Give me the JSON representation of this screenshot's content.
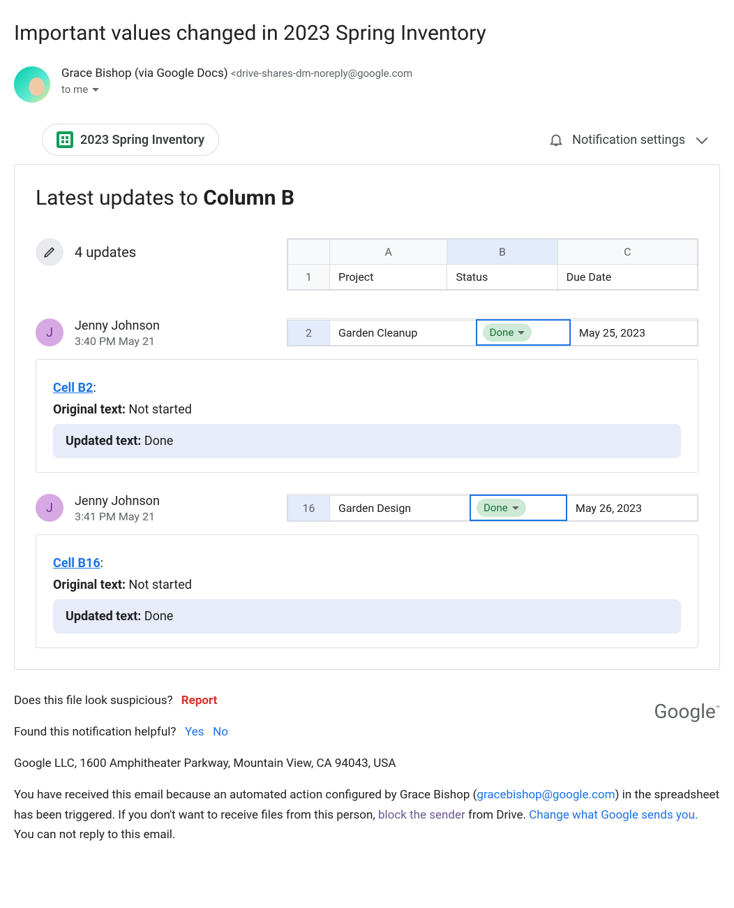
{
  "subject": "Important values changed in 2023 Spring Inventory",
  "sender": {
    "name": "Grace Bishop (via Google Docs)",
    "email": "<drive-shares-dm-noreply@google.com",
    "recipient": "to me"
  },
  "file_chip": "2023 Spring Inventory",
  "notification_settings_label": "Notification settings",
  "card": {
    "title_prefix": "Latest updates to ",
    "title_bold": "Column B",
    "summary": "4 updates",
    "header_cols": {
      "a": "A",
      "b": "B",
      "c": "C"
    },
    "header_row": {
      "num": "1",
      "project": "Project",
      "status": "Status",
      "due": "Due Date"
    }
  },
  "updates": [
    {
      "initial": "J",
      "name": "Jenny Johnson",
      "time": "3:40 PM May 21",
      "row": {
        "num": "2",
        "project": "Garden Cleanup",
        "status": "Done",
        "due": "May 25, 2023"
      },
      "cell_label": "Cell B2",
      "original_label": "Original text:",
      "original_value": " Not started",
      "updated_label": "Updated text:",
      "updated_value": " Done"
    },
    {
      "initial": "J",
      "name": "Jenny Johnson",
      "time": "3:41 PM May 21",
      "row": {
        "num": "16",
        "project": "Garden Design",
        "status": "Done",
        "due": "May 26, 2023"
      },
      "cell_label": "Cell B16",
      "original_label": "Original text:",
      "original_value": " Not started",
      "updated_label": "Updated text:",
      "updated_value": " Done"
    }
  ],
  "footer": {
    "suspicious": "Does this file look suspicious?",
    "report": "Report",
    "helpful": "Found this notification helpful?",
    "yes": "Yes",
    "no": "No",
    "address": "Google LLC, 1600 Amphitheater Parkway, Mountain View, CA 94043, USA",
    "reason1": "You have received this email because an automated action configured by Grace Bishop (",
    "reason_email": "gracebishop@google.com",
    "reason2": ") in the spreadsheet has been triggered. If you don't want to receive files from this person, ",
    "block_link": "block the sender",
    "reason3": " from Drive. ",
    "change_link": "Change what Google sends you.",
    "reason4": " You can not reply to this email.",
    "logo": "Google"
  }
}
